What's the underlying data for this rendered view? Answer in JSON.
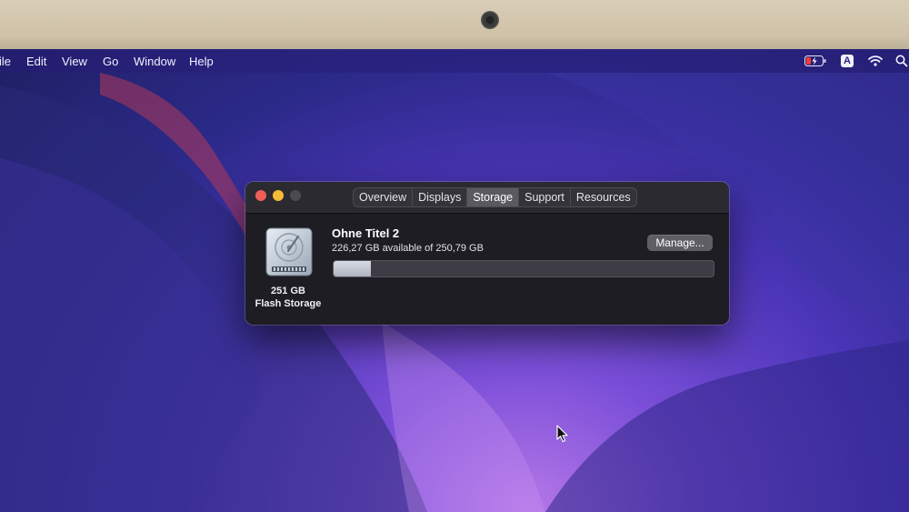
{
  "menubar": {
    "items": [
      "ile",
      "Edit",
      "View",
      "Go",
      "Window",
      "Help"
    ],
    "status_icons": [
      "battery-charging-icon",
      "input-source-icon",
      "wifi-icon",
      "spotlight-search-icon"
    ],
    "input_source_letter": "A"
  },
  "window": {
    "traffic_lights": [
      {
        "name": "close",
        "color": "#ee5e57"
      },
      {
        "name": "minimize",
        "color": "#f3bc36"
      },
      {
        "name": "zoom",
        "color": "#4d4b52"
      }
    ],
    "tabs": [
      {
        "label": "Overview",
        "active": false
      },
      {
        "label": "Displays",
        "active": false
      },
      {
        "label": "Storage",
        "active": true
      },
      {
        "label": "Support",
        "active": false
      },
      {
        "label": "Resources",
        "active": false
      }
    ],
    "storage": {
      "disk_icon": "hard-drive-icon",
      "capacity": "251 GB",
      "type": "Flash Storage",
      "volume_name": "Ohne Titel 2",
      "available_text": "226,27 GB available of 250,79 GB",
      "used_fraction": 0.0977,
      "manage_label": "Manage..."
    }
  },
  "colors": {
    "window_bg": "#222027",
    "titlebar_bg": "#2c2a31",
    "active_tab_bg": "#5a5861",
    "usage_bar": "#c2c6d1"
  }
}
